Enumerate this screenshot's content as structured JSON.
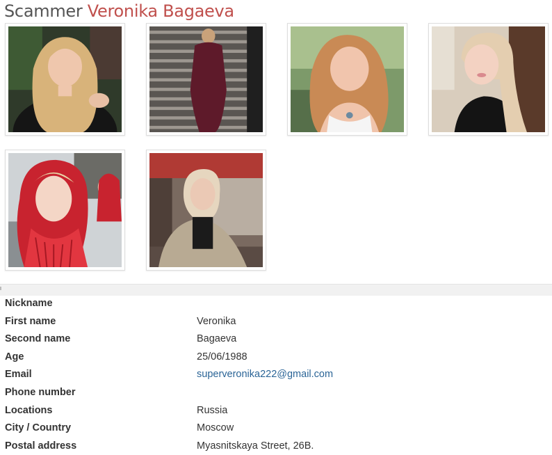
{
  "header": {
    "prefix": "Scammer",
    "name": "Veronika Bagaeva"
  },
  "gallery": {
    "photos": [
      {
        "icon": "photo-portrait-long-blonde-hair-icon"
      },
      {
        "icon": "photo-woman-on-stairs-icon"
      },
      {
        "icon": "photo-selfie-outdoors-icon"
      },
      {
        "icon": "photo-selfie-indoors-icon"
      },
      {
        "icon": "photo-woman-in-red-headscarf-icon"
      },
      {
        "icon": "photo-woman-in-cafe-icon"
      }
    ]
  },
  "profile": {
    "rows": [
      {
        "label": "Nickname",
        "value": ""
      },
      {
        "label": "First name",
        "value": "Veronika"
      },
      {
        "label": "Second name",
        "value": "Bagaeva"
      },
      {
        "label": "Age",
        "value": "25/06/1988"
      },
      {
        "label": "Email",
        "value": "superveronika222@gmail.com"
      },
      {
        "label": "Phone number",
        "value": ""
      },
      {
        "label": "Locations",
        "value": "Russia"
      },
      {
        "label": "City / Country",
        "value": "Moscow"
      },
      {
        "label": "Postal address",
        "value": "Myasnitskaya Street, 26B."
      }
    ]
  },
  "colors": {
    "title_gray": "#555555",
    "title_accent": "#c0504d",
    "link": "#2a6496",
    "divider": "#f1f1f1"
  }
}
